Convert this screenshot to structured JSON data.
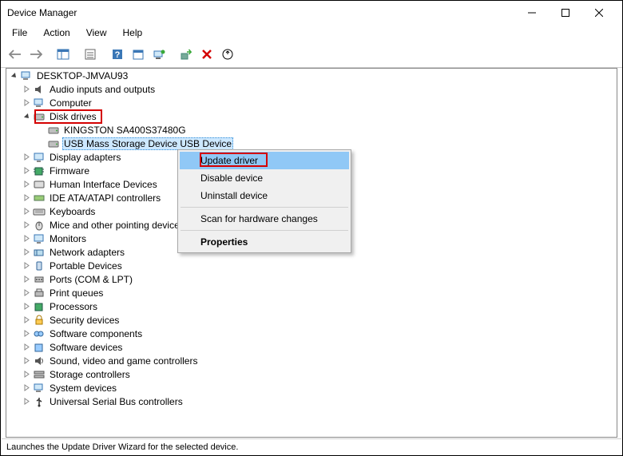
{
  "window": {
    "title": "Device Manager"
  },
  "menu": [
    "File",
    "Action",
    "View",
    "Help"
  ],
  "tree": {
    "root": "DESKTOP-JMVAU93",
    "categories": [
      {
        "label": "Audio inputs and outputs",
        "icon": "audio"
      },
      {
        "label": "Computer",
        "icon": "computer"
      },
      {
        "label": "Disk drives",
        "icon": "disk",
        "expanded": true,
        "highlighted_box": true,
        "children": [
          {
            "label": "KINGSTON SA400S37480G",
            "icon": "disk"
          },
          {
            "label": "USB Mass  Storage Device USB Device",
            "icon": "disk",
            "selected": true
          }
        ]
      },
      {
        "label": "Display adapters",
        "icon": "display"
      },
      {
        "label": "Firmware",
        "icon": "chip"
      },
      {
        "label": "Human Interface Devices",
        "icon": "hid"
      },
      {
        "label": "IDE ATA/ATAPI controllers",
        "icon": "ide"
      },
      {
        "label": "Keyboards",
        "icon": "keyboard"
      },
      {
        "label": "Mice and other pointing devices",
        "icon": "mouse"
      },
      {
        "label": "Monitors",
        "icon": "monitor"
      },
      {
        "label": "Network adapters",
        "icon": "network"
      },
      {
        "label": "Portable Devices",
        "icon": "portable"
      },
      {
        "label": "Ports (COM & LPT)",
        "icon": "port"
      },
      {
        "label": "Print queues",
        "icon": "printer"
      },
      {
        "label": "Processors",
        "icon": "cpu"
      },
      {
        "label": "Security devices",
        "icon": "security"
      },
      {
        "label": "Software components",
        "icon": "swcomp"
      },
      {
        "label": "Software devices",
        "icon": "swdev"
      },
      {
        "label": "Sound, video and game controllers",
        "icon": "sound"
      },
      {
        "label": "Storage controllers",
        "icon": "storage"
      },
      {
        "label": "System devices",
        "icon": "system"
      },
      {
        "label": "Universal Serial Bus controllers",
        "icon": "usb"
      }
    ]
  },
  "context_menu": {
    "items": [
      {
        "label": "Update driver",
        "highlight": true,
        "red_box": true
      },
      {
        "label": "Disable device"
      },
      {
        "label": "Uninstall device"
      },
      {
        "separator": true
      },
      {
        "label": "Scan for hardware changes"
      },
      {
        "separator": true
      },
      {
        "label": "Properties",
        "bold": true
      }
    ]
  },
  "status_text": "Launches the Update Driver Wizard for the selected device."
}
